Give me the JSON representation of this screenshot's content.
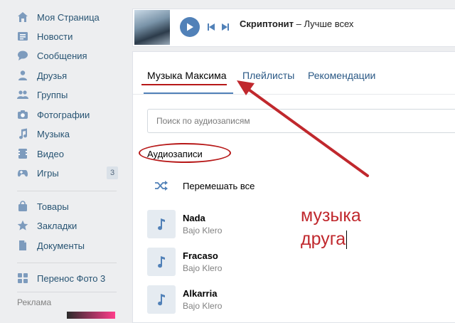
{
  "sidebar": {
    "items": [
      {
        "label": "Моя Страница",
        "icon": "home-icon"
      },
      {
        "label": "Новости",
        "icon": "news-icon"
      },
      {
        "label": "Сообщения",
        "icon": "messages-icon"
      },
      {
        "label": "Друзья",
        "icon": "friend-icon"
      },
      {
        "label": "Группы",
        "icon": "groups-icon"
      },
      {
        "label": "Фотографии",
        "icon": "camera-icon"
      },
      {
        "label": "Музыка",
        "icon": "music-note-icon"
      },
      {
        "label": "Видео",
        "icon": "video-icon"
      },
      {
        "label": "Игры",
        "icon": "gamepad-icon",
        "count": "3"
      },
      {
        "label": "Товары",
        "icon": "shopping-bag-icon"
      },
      {
        "label": "Закладки",
        "icon": "star-icon"
      },
      {
        "label": "Документы",
        "icon": "document-icon"
      },
      {
        "label": "Перенос Фото 3",
        "icon": "app-grid-icon"
      }
    ],
    "ad_label": "Реклама"
  },
  "player": {
    "artist": "Скриптонит",
    "separator": " – ",
    "song": "Лучше всех"
  },
  "tabs": [
    {
      "label": "Музыка Максима",
      "active": true
    },
    {
      "label": "Плейлисты",
      "active": false
    },
    {
      "label": "Рекомендации",
      "active": false
    }
  ],
  "search": {
    "placeholder": "Поиск по аудиозаписям"
  },
  "section_title": "Аудиозаписи",
  "shuffle_label": "Перемешать все",
  "tracks": [
    {
      "title": "Nada",
      "artist": "Bajo Klero"
    },
    {
      "title": "Fracaso",
      "artist": "Bajo Klero"
    },
    {
      "title": "Alkarria",
      "artist": "Bajo Klero"
    }
  ],
  "annotation": {
    "line1": "музыка",
    "line2": "друга"
  },
  "colors": {
    "accent": "#5181b8",
    "link": "#2a5885",
    "annotation": "#c0282d"
  }
}
